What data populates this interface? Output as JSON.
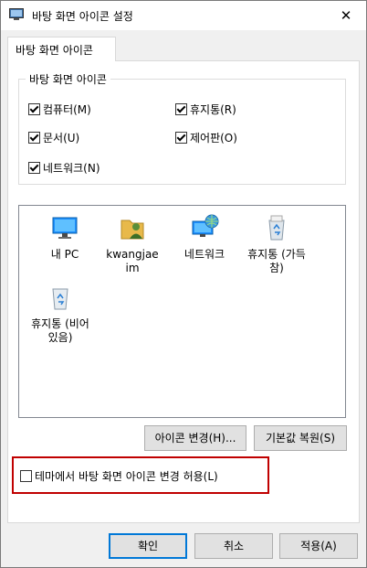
{
  "window": {
    "title": "바탕 화면 아이콘 설정",
    "close_label": "✕"
  },
  "tab": {
    "label": "바탕 화면 아이콘"
  },
  "group": {
    "label": "바탕 화면 아이콘",
    "checkboxes": [
      {
        "label": "컴퓨터(M)",
        "checked": true
      },
      {
        "label": "휴지통(R)",
        "checked": true
      },
      {
        "label": "문서(U)",
        "checked": true
      },
      {
        "label": "제어판(O)",
        "checked": true
      },
      {
        "label": "네트워크(N)",
        "checked": true
      }
    ]
  },
  "icons": [
    {
      "line1": "내 PC",
      "line2": "",
      "icon": "computer-icon"
    },
    {
      "line1": "kwangjae",
      "line2": "im",
      "icon": "user-folder-icon"
    },
    {
      "line1": "네트워크",
      "line2": "",
      "icon": "network-icon"
    },
    {
      "line1": "휴지통 (가득",
      "line2": "참)",
      "icon": "recycle-bin-full-icon"
    },
    {
      "line1": "휴지통 (비어",
      "line2": "있음)",
      "icon": "recycle-bin-empty-icon"
    }
  ],
  "buttons": {
    "change_icon": "아이콘 변경(H)...",
    "restore_default": "기본값 복원(S)"
  },
  "theme_checkbox": {
    "label": "테마에서 바탕 화면 아이콘 변경 허용(L)",
    "checked": false
  },
  "footer": {
    "ok": "확인",
    "cancel": "취소",
    "apply": "적용(A)"
  },
  "colors": {
    "accent": "#0078d7",
    "highlight_box": "#c00000"
  }
}
